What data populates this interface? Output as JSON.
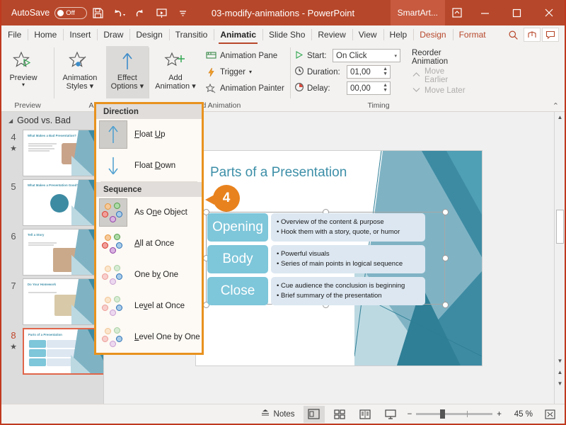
{
  "titlebar": {
    "autosave_label": "AutoSave",
    "autosave_state": "Off",
    "document_title": "03-modify-animations  -  PowerPoint",
    "contextual_tab": "SmartArt...",
    "icons": [
      "save-icon",
      "undo-icon",
      "redo-icon",
      "start-presentation-icon",
      "customize-quick-access-icon"
    ],
    "window_buttons": [
      "minimize",
      "maximize",
      "close"
    ],
    "accent_color": "#b7472a"
  },
  "tabs": [
    {
      "label": "File",
      "active": false,
      "contextual": false
    },
    {
      "label": "Home",
      "active": false,
      "contextual": false
    },
    {
      "label": "Insert",
      "active": false,
      "contextual": false
    },
    {
      "label": "Draw",
      "active": false,
      "contextual": false
    },
    {
      "label": "Design",
      "active": false,
      "contextual": false
    },
    {
      "label": "Transitio",
      "active": false,
      "contextual": false
    },
    {
      "label": "Animatic",
      "active": true,
      "contextual": false
    },
    {
      "label": "Slide Sho",
      "active": false,
      "contextual": false
    },
    {
      "label": "Review",
      "active": false,
      "contextual": false
    },
    {
      "label": "View",
      "active": false,
      "contextual": false
    },
    {
      "label": "Help",
      "active": false,
      "contextual": false
    },
    {
      "label": "Design",
      "active": false,
      "contextual": true
    },
    {
      "label": "Format",
      "active": false,
      "contextual": true
    }
  ],
  "ribbon": {
    "groups": [
      {
        "name": "Preview",
        "label": "Preview"
      },
      {
        "name": "Animation",
        "label": "Animati"
      },
      {
        "name": "AdvancedAnimation",
        "label": "ed Animation"
      },
      {
        "name": "Timing",
        "label": "Timing"
      }
    ],
    "preview_button": {
      "line1": "Preview",
      "line2": ""
    },
    "animation_styles": {
      "line1": "Animation",
      "line2": "Styles"
    },
    "effect_options": {
      "line1": "Effect",
      "line2": "Options",
      "active": true
    },
    "add_animation": {
      "line1": "Add",
      "line2": "Animation"
    },
    "advanced": [
      {
        "label": "Animation Pane",
        "icon": "animation-pane-icon"
      },
      {
        "label": "Trigger",
        "icon": "trigger-icon",
        "has_caret": true
      },
      {
        "label": "Animation Painter",
        "icon": "animation-painter-icon"
      }
    ],
    "timing": {
      "start_label": "Start:",
      "start_value": "On Click",
      "duration_label": "Duration:",
      "duration_value": "01,00",
      "delay_label": "Delay:",
      "delay_value": "00,00"
    },
    "reorder": {
      "title": "Reorder Animation",
      "move_earlier": "Move Earlier",
      "move_later": "Move Later"
    }
  },
  "effect_options_menu": {
    "direction_header": "Direction",
    "sequence_header": "Sequence",
    "direction_items": [
      {
        "label": "Float Up",
        "selected": true,
        "icon": "arrow-up-icon"
      },
      {
        "label": "Float Down",
        "selected": false,
        "icon": "arrow-down-icon"
      }
    ],
    "sequence_items": [
      {
        "label": "As One Object",
        "selected": true,
        "icon": "sequence-dots-icon"
      },
      {
        "label": "All at Once",
        "selected": false,
        "icon": "sequence-dots-icon"
      },
      {
        "label": "One by One",
        "selected": false,
        "icon": "sequence-dots-icon"
      },
      {
        "label": "Level at Once",
        "selected": false,
        "icon": "sequence-dots-icon"
      },
      {
        "label": "Level One by One",
        "selected": false,
        "icon": "sequence-dots-icon"
      }
    ]
  },
  "thumbnails": {
    "section_title": "Good vs. Bad",
    "slides": [
      {
        "number": "4",
        "title": "What Makes a Bad Presentation?",
        "animated": true,
        "selected": false
      },
      {
        "number": "5",
        "title": "What Makes a Presentation Good?",
        "animated": false,
        "selected": false
      },
      {
        "number": "6",
        "title": "Tell a Story",
        "animated": false,
        "selected": false
      },
      {
        "number": "7",
        "title": "Do Your Homework",
        "animated": false,
        "selected": false
      },
      {
        "number": "8",
        "title": "Parts of a Presentation",
        "animated": true,
        "selected": true
      }
    ]
  },
  "slide": {
    "title": "Parts of a Presentation",
    "callout_number": "4",
    "rows": [
      {
        "label": "Opening",
        "bullets": [
          "Overview of the content & purpose",
          "Hook them with a story, quote, or humor"
        ]
      },
      {
        "label": "Body",
        "bullets": [
          "Powerful visuals",
          "Series of main points in logical sequence"
        ]
      },
      {
        "label": "Close",
        "bullets": [
          "Cue audience the conclusion is beginning",
          "Brief summary of the presentation"
        ]
      }
    ]
  },
  "statusbar": {
    "notes_label": "Notes",
    "views": [
      {
        "name": "normal-view",
        "active": true
      },
      {
        "name": "slide-sorter-view",
        "active": false
      },
      {
        "name": "reading-view",
        "active": false
      },
      {
        "name": "slideshow-view",
        "active": false
      }
    ],
    "zoom_out": "−",
    "zoom_in": "+",
    "zoom_level": "45 %",
    "fit_label": "fit-to-window-icon"
  }
}
